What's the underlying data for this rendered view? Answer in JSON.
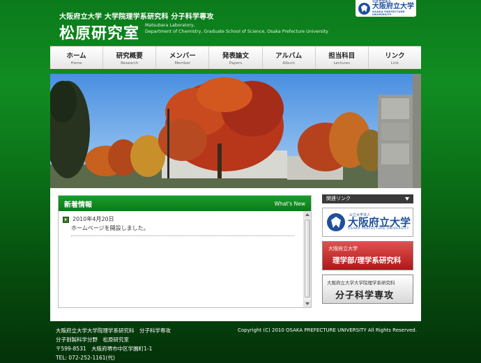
{
  "header": {
    "university_line": "大阪府立大学 大学院理学系研究科 分子科学専攻",
    "lab_title": "松原研究室",
    "lab_sub_1": "Matsubara Laboratory,",
    "lab_sub_2": "Department of Chemistry, Graduate School of Science, Osaka Prefecture University",
    "logo": {
      "small": "公立大学法人",
      "big": "大阪府立大学",
      "eng": "OSAKA PREFECTURE UNIVERSITY"
    }
  },
  "nav": {
    "items": [
      {
        "jp": "ホーム",
        "en": "Home"
      },
      {
        "jp": "研究概要",
        "en": "Research"
      },
      {
        "jp": "メンバー",
        "en": "Member"
      },
      {
        "jp": "発表論文",
        "en": "Papers"
      },
      {
        "jp": "アルバム",
        "en": "Album"
      },
      {
        "jp": "担当科目",
        "en": "Lectures"
      },
      {
        "jp": "リンク",
        "en": "Link"
      }
    ]
  },
  "news": {
    "title": "新着情報",
    "title_en": "What's New",
    "items": [
      {
        "date": "2010年4月20日",
        "text": "ホームページを開設しました。"
      }
    ]
  },
  "sidebar": {
    "heading": "関連リンク",
    "banner_opu": {
      "small": "公立大学法人",
      "big": "大阪府立大学",
      "eng": "OSAKA PREFECTURE UNIVERSITY"
    },
    "banner_sci": {
      "small": "大阪府立大学",
      "big": "理学部/理学系研究科"
    },
    "banner_mol": {
      "small": "大阪府立大学大学院理学系研究科",
      "big": "分子科学専攻"
    }
  },
  "footer": {
    "line1": "大阪府立大学大学院理学系研究科　分子科学専攻",
    "line2": "分子割製科学分野　松原研究室",
    "line3": "〒599-8531　大阪府堺市中区学園町1-1",
    "line4": "TEL: 072-252-1161(代)",
    "copyright": "Copyright (C) 2010 OSAKA PREFECTURE UNIVERSITY All Rights Reserved."
  },
  "colors": {
    "brand_green": "#0c7a18",
    "opu_blue": "#1f4f9a",
    "science_red": "#b01818"
  }
}
